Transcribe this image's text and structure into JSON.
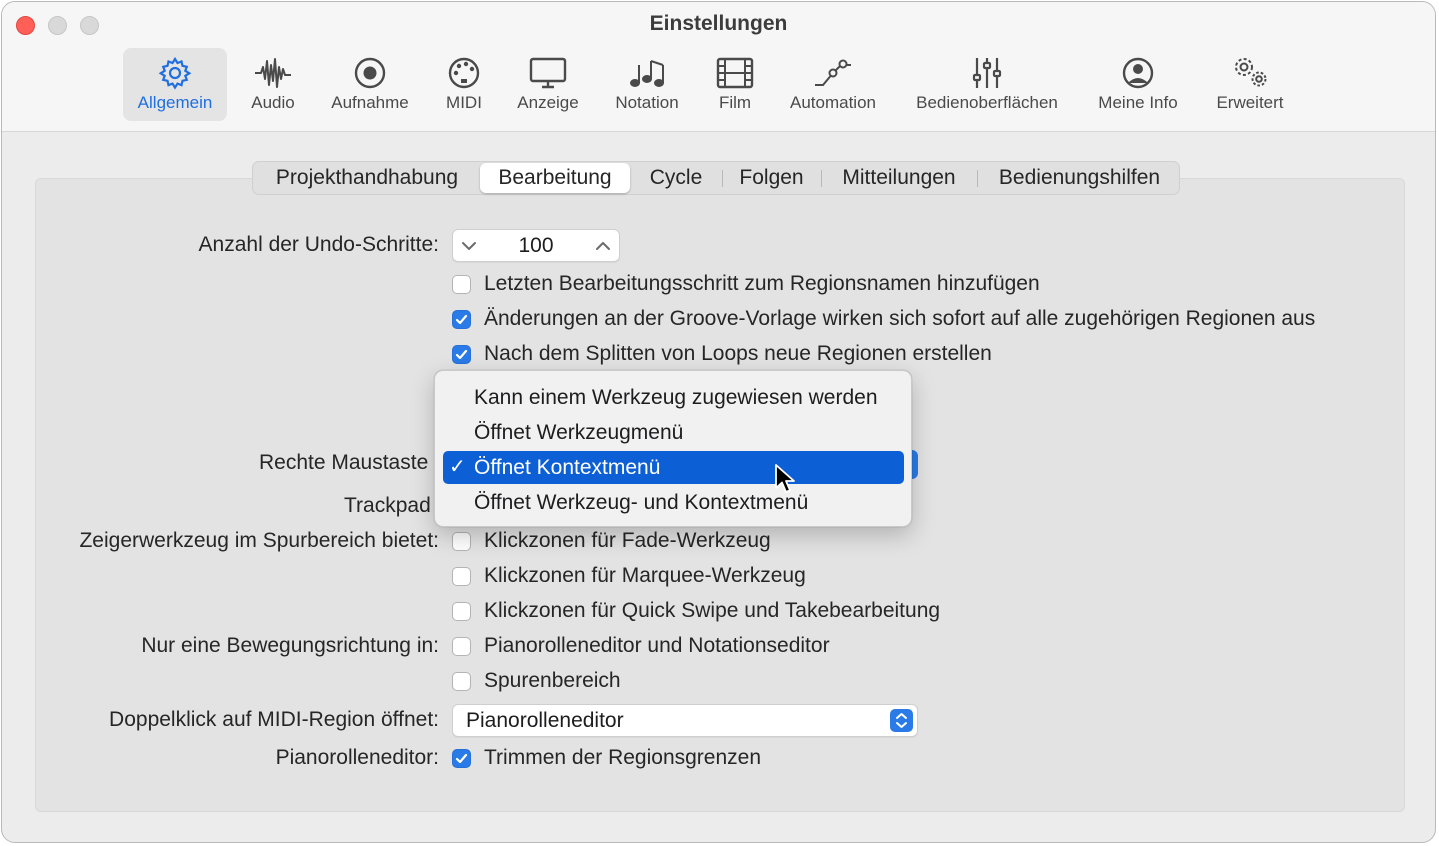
{
  "window": {
    "title": "Einstellungen"
  },
  "toolbar": {
    "items": [
      {
        "label": "Allgemein",
        "icon": "gear-icon"
      },
      {
        "label": "Audio",
        "icon": "waveform-icon"
      },
      {
        "label": "Aufnahme",
        "icon": "record-icon"
      },
      {
        "label": "MIDI",
        "icon": "palette-icon"
      },
      {
        "label": "Anzeige",
        "icon": "display-icon"
      },
      {
        "label": "Notation",
        "icon": "notes-icon"
      },
      {
        "label": "Film",
        "icon": "film-icon"
      },
      {
        "label": "Automation",
        "icon": "automation-icon"
      },
      {
        "label": "Bedienoberflächen",
        "icon": "sliders-icon"
      },
      {
        "label": "Meine Info",
        "icon": "person-icon"
      },
      {
        "label": "Erweitert",
        "icon": "gears-icon"
      }
    ],
    "active": "Allgemein"
  },
  "tabs": {
    "items": [
      "Projekthandhabung",
      "Bearbeitung",
      "Cycle",
      "Folgen",
      "Mitteilungen",
      "Bedienungshilfen"
    ],
    "active": "Bearbeitung"
  },
  "settings": {
    "undo_label": "Anzahl der Undo-Schritte:",
    "undo_value": "100",
    "cb_last_edit": {
      "label": "Letzten Bearbeitungsschritt zum Regionsnamen hinzufügen",
      "checked": false
    },
    "cb_groove": {
      "label": "Änderungen an der Groove-Vorlage wirken sich sofort auf alle zugehörigen Regionen aus",
      "checked": true
    },
    "cb_split_loops": {
      "label": "Nach dem Splitten von Loops neue Regionen erstellen",
      "checked": true
    },
    "right_mouse_label": "Rechte Maustaste",
    "trackpad_label": "Trackpad",
    "pointer_tool_label": "Zeigerwerkzeug im Spurbereich bietet:",
    "cb_fade": {
      "label": "Klickzonen für Fade-Werkzeug",
      "checked": false
    },
    "cb_marquee": {
      "label": "Klickzonen für Marquee-Werkzeug",
      "checked": false
    },
    "cb_quickswipe": {
      "label": "Klickzonen für Quick Swipe und Takebearbeitung",
      "checked": false
    },
    "one_direction_label": "Nur eine Bewegungsrichtung in:",
    "cb_pianoroll_notation": {
      "label": "Pianorolleneditor und Notationseditor",
      "checked": false
    },
    "cb_tracks": {
      "label": "Spurenbereich",
      "checked": false
    },
    "doubleclick_label": "Doppelklick auf MIDI-Region öffnet:",
    "doubleclick_value": "Pianorolleneditor",
    "pianoroll_label": "Pianorolleneditor:",
    "cb_trim": {
      "label": "Trimmen der Regionsgrenzen",
      "checked": true
    }
  },
  "popup_menu": {
    "items": [
      "Kann einem Werkzeug zugewiesen werden",
      "Öffnet Werkzeugmenü",
      "Öffnet Kontextmenü",
      "Öffnet Werkzeug- und Kontextmenü"
    ],
    "selected": "Öffnet Kontextmenü",
    "check_glyph": "✓"
  },
  "colors": {
    "accent": "#2a7be8",
    "menu_highlight": "#0d5fd6",
    "active_toolbar_text": "#1f6fe0"
  }
}
